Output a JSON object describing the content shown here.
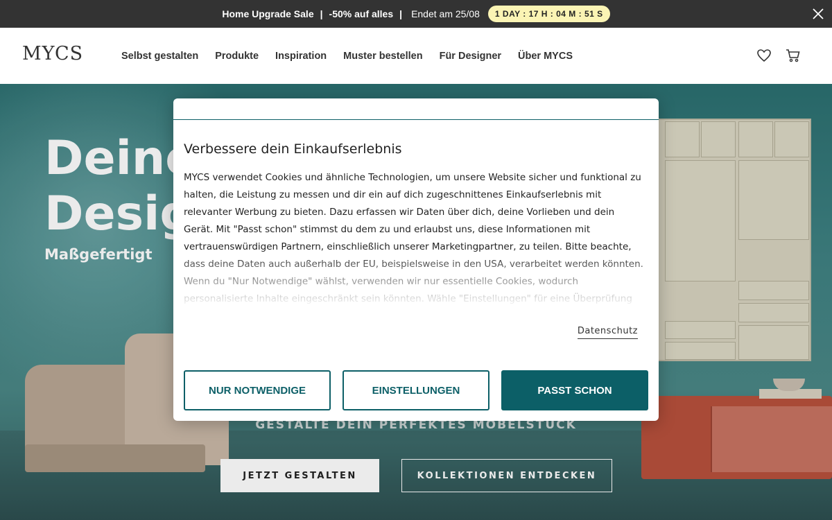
{
  "promo": {
    "title": "Home Upgrade Sale",
    "separator1": "|",
    "discount": "-50% auf alles",
    "separator2": "|",
    "ends": "Endet am 25/08",
    "countdown": "1 DAY : 17 H : 04 M : 51 S",
    "close_icon": "close-icon"
  },
  "header": {
    "logo": "MYCS",
    "nav": [
      "Selbst gestalten",
      "Produkte",
      "Inspiration",
      "Muster bestellen",
      "Für Designer",
      "Über MYCS"
    ],
    "icons": [
      "heart-icon",
      "cart-icon"
    ]
  },
  "hero": {
    "title_line1": "Deine",
    "title_line2": "Desig",
    "subtitle": "Maßgefertigt",
    "tagline": "GESTALTE DEIN PERFEKTES MÖBELSTÜCK",
    "primary_button": "JETZT GESTALTEN",
    "secondary_button": "KOLLEKTIONEN ENTDECKEN"
  },
  "cookie_modal": {
    "title": "Verbessere dein Einkaufserlebnis",
    "body": "MYCS verwendet Cookies und ähnliche Technologien, um unsere Website sicher und funktional zu halten, die Leistung zu messen und dir ein auf dich zugeschnittenes Einkaufserlebnis mit relevanter Werbung zu bieten. Dazu erfassen wir Daten über dich, deine Vorlieben und dein Gerät. Mit \"Passt schon\" stimmst du dem zu und erlaubst uns, diese Informationen mit vertrauenswürdigen Partnern, einschließlich unserer Marketingpartner, zu teilen. Bitte beachte, dass deine Daten auch außerhalb der EU, beispielsweise in den USA, verarbeitet werden könnten. Wenn du \"Nur Notwendige\" wählst, verwenden wir nur essentielle Cookies, wodurch personalisierte Inhalte eingeschränkt sein könnten. Wähle \"Einstellungen\" für eine Überprüfung",
    "privacy_link": "Datenschutz",
    "btn_necessary": "NUR NOTWENDIGE",
    "btn_settings": "EINSTELLUNGEN",
    "btn_accept": "PASST SCHON"
  },
  "colors": {
    "accent": "#0c5f67",
    "promo_bg": "#333333",
    "countdown_bg": "#fbf4b4"
  }
}
